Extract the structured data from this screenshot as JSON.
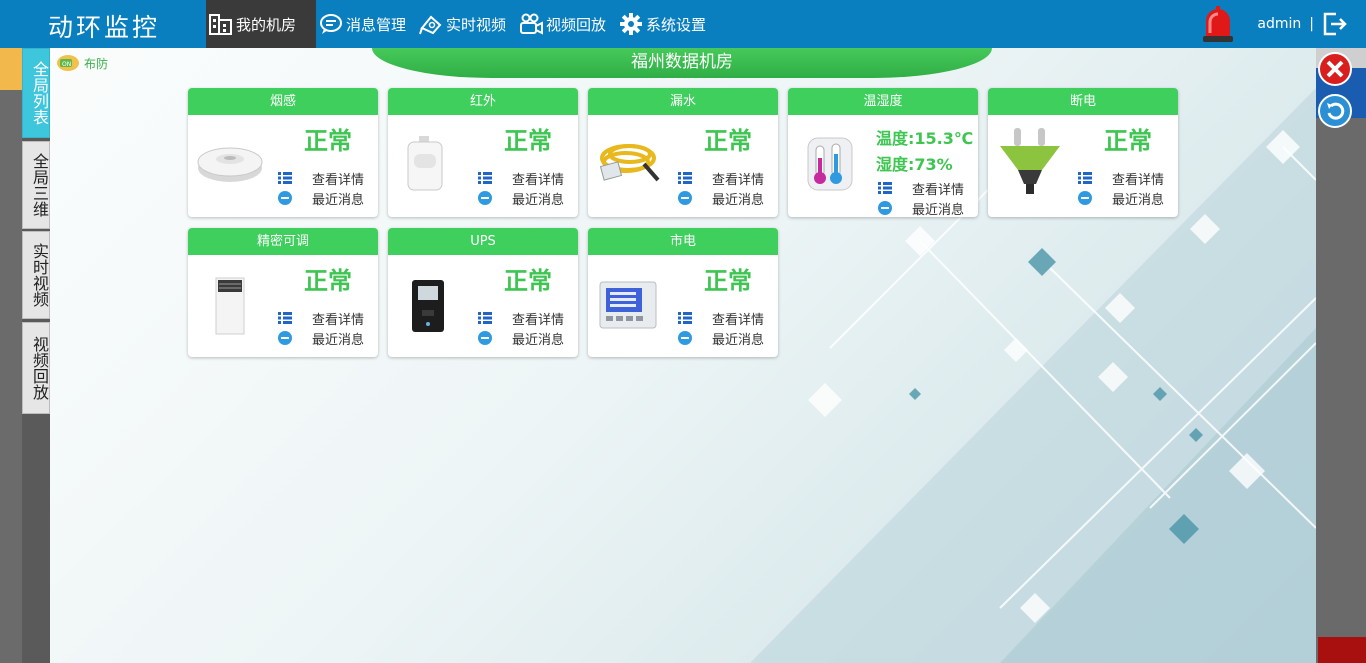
{
  "app": {
    "title": "动环监控"
  },
  "nav": [
    {
      "label": "我的机房",
      "icon": "building-icon",
      "active": true
    },
    {
      "label": "消息管理",
      "icon": "message-icon",
      "active": false
    },
    {
      "label": "实时视频",
      "icon": "video-icon",
      "active": false
    },
    {
      "label": "视频回放",
      "icon": "camera-icon",
      "active": false
    },
    {
      "label": "系统设置",
      "icon": "gear-icon",
      "active": false
    }
  ],
  "user": {
    "name": "admin",
    "separator": "|"
  },
  "side_tabs": [
    {
      "label": "全局列表",
      "active": true
    },
    {
      "label": "全局三维",
      "active": false
    },
    {
      "label": "实时视频",
      "active": false
    },
    {
      "label": "视频回放",
      "active": false
    }
  ],
  "arm_label": "布防",
  "room": {
    "title": "福州数据机房"
  },
  "card_actions": {
    "detail": "查看详情",
    "recent": "最近消息"
  },
  "cards": [
    {
      "title": "烟感",
      "status": "正常",
      "icon": "smoke-detector-icon"
    },
    {
      "title": "红外",
      "status": "正常",
      "icon": "infrared-sensor-icon"
    },
    {
      "title": "漏水",
      "status": "正常",
      "icon": "water-leak-cable-icon"
    },
    {
      "title": "温湿度",
      "temp": "温度:15.3℃",
      "humidity": "湿度:73%",
      "icon": "thermometer-icon"
    },
    {
      "title": "断电",
      "status": "正常",
      "icon": "power-plug-icon"
    },
    {
      "title": "精密可调",
      "status": "正常",
      "icon": "precision-ac-icon"
    },
    {
      "title": "UPS",
      "status": "正常",
      "icon": "ups-icon"
    },
    {
      "title": "市电",
      "status": "正常",
      "icon": "power-meter-icon"
    }
  ],
  "colors": {
    "topbar": "#0a7fbf",
    "card_header": "#3ecf5d",
    "status_ok": "#3ec552",
    "active_tab": "#3ec6dc"
  }
}
